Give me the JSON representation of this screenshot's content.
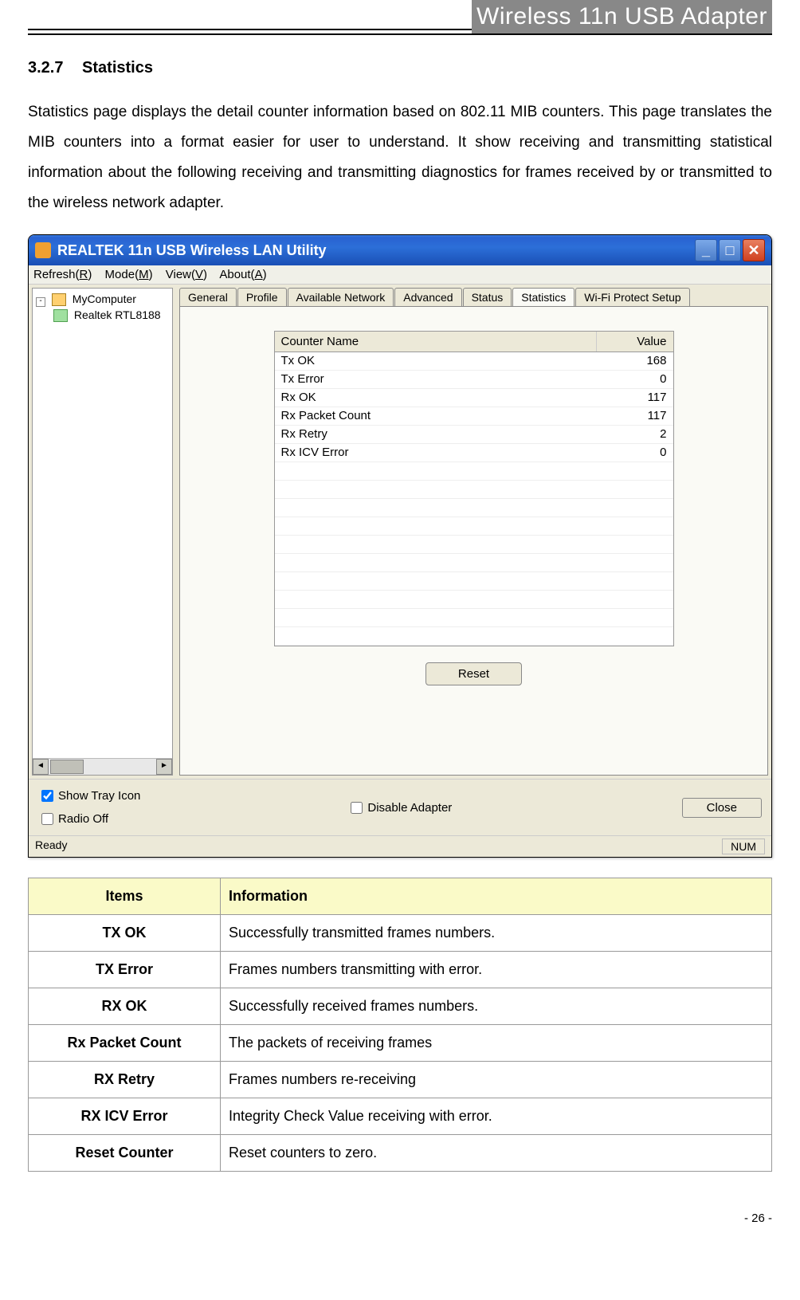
{
  "header": {
    "doc_title": "Wireless 11n USB Adapter"
  },
  "section": {
    "number": "3.2.7",
    "title": "Statistics",
    "body": "Statistics page displays the detail counter information based on 802.11 MIB counters. This page translates the MIB counters into a format easier for user to understand. It show receiving and transmitting statistical information about the following receiving and transmitting diagnostics for frames received by or transmitted to the wireless network adapter."
  },
  "window": {
    "title": "REALTEK 11n USB Wireless LAN Utility",
    "menus": [
      {
        "label": "Refresh(",
        "hot": "R",
        "tail": ")"
      },
      {
        "label": "Mode(",
        "hot": "M",
        "tail": ")"
      },
      {
        "label": "View(",
        "hot": "V",
        "tail": ")"
      },
      {
        "label": "About(",
        "hot": "A",
        "tail": ")"
      }
    ],
    "tree": {
      "root": "MyComputer",
      "child": "Realtek RTL8188"
    },
    "tabs": [
      "General",
      "Profile",
      "Available Network",
      "Advanced",
      "Status",
      "Statistics",
      "Wi-Fi Protect Setup"
    ],
    "active_tab": "Statistics",
    "stats_header": {
      "name": "Counter Name",
      "value": "Value"
    },
    "stats": [
      {
        "name": "Tx OK",
        "value": "168"
      },
      {
        "name": "Tx Error",
        "value": "0"
      },
      {
        "name": "Rx OK",
        "value": "117"
      },
      {
        "name": "Rx Packet Count",
        "value": "117"
      },
      {
        "name": "Rx Retry",
        "value": "2"
      },
      {
        "name": "Rx ICV Error",
        "value": "0"
      }
    ],
    "empty_rows": 10,
    "reset_label": "Reset",
    "checks": {
      "show_tray": {
        "label": "Show Tray Icon",
        "checked": true
      },
      "radio_off": {
        "label": "Radio Off",
        "checked": false
      },
      "disable_adapter": {
        "label": "Disable Adapter",
        "checked": false
      }
    },
    "close_label": "Close",
    "status": {
      "ready": "Ready",
      "num": "NUM"
    }
  },
  "info_table": {
    "headers": {
      "items": "Items",
      "info": "Information"
    },
    "rows": [
      {
        "item": "TX OK",
        "info": "Successfully transmitted frames numbers."
      },
      {
        "item": "TX Error",
        "info": "Frames numbers transmitting with error."
      },
      {
        "item": "RX OK",
        "info": "Successfully received frames numbers."
      },
      {
        "item": "Rx Packet Count",
        "info": "The packets of receiving frames"
      },
      {
        "item": "RX Retry",
        "info": "Frames numbers re-receiving"
      },
      {
        "item": "RX ICV Error",
        "info": "Integrity Check Value receiving with error."
      },
      {
        "item": "Reset Counter",
        "info": "Reset counters to zero."
      }
    ]
  },
  "page_number": "- 26 -"
}
